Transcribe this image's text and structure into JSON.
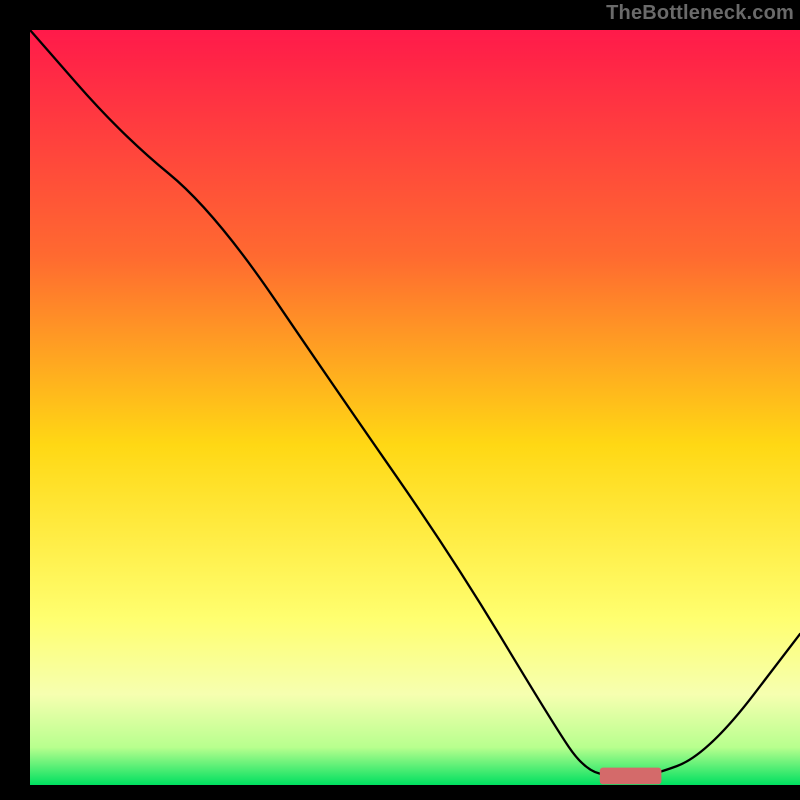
{
  "watermark": "TheBottleneck.com",
  "chart_data": {
    "type": "line",
    "title": "",
    "xlabel": "",
    "ylabel": "",
    "xlim": [
      0,
      100
    ],
    "ylim": [
      0,
      100
    ],
    "grid": false,
    "legend": false,
    "background_gradient": {
      "stops": [
        {
          "pos": 0.0,
          "color": "#ff1a4a"
        },
        {
          "pos": 0.3,
          "color": "#ff6a30"
        },
        {
          "pos": 0.55,
          "color": "#ffd814"
        },
        {
          "pos": 0.78,
          "color": "#ffff70"
        },
        {
          "pos": 0.88,
          "color": "#f6ffb0"
        },
        {
          "pos": 0.95,
          "color": "#b8ff8e"
        },
        {
          "pos": 1.0,
          "color": "#00e060"
        }
      ]
    },
    "curve": {
      "name": "bottleneck-curve",
      "color": "#000000",
      "width": 2.3,
      "x": [
        0,
        12,
        24,
        40,
        55,
        68,
        72,
        76,
        80,
        88,
        100
      ],
      "y": [
        100,
        86,
        76,
        52,
        30,
        8,
        2,
        1,
        1,
        4,
        20
      ]
    },
    "marker": {
      "name": "optimal-range-marker",
      "color": "#d46a6a",
      "x_start": 74,
      "x_end": 82,
      "y": 1.2,
      "thickness": 2.2
    }
  }
}
